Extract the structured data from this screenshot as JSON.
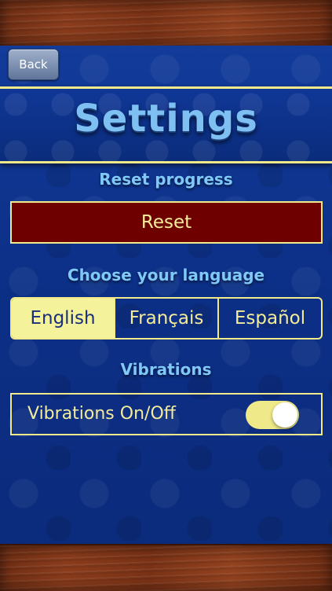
{
  "nav": {
    "back_label": "Back"
  },
  "page": {
    "title": "Settings"
  },
  "reset": {
    "section_label": "Reset progress",
    "button_label": "Reset"
  },
  "language": {
    "section_label": "Choose your language",
    "options": [
      "English",
      "Français",
      "Español"
    ],
    "selected": "English"
  },
  "vibrations": {
    "section_label": "Vibrations",
    "toggle_label": "Vibrations On/Off",
    "enabled": true
  },
  "colors": {
    "accent": "#f2e98a",
    "section_label": "#7fc8f8",
    "reset_background": "#6e0000"
  }
}
